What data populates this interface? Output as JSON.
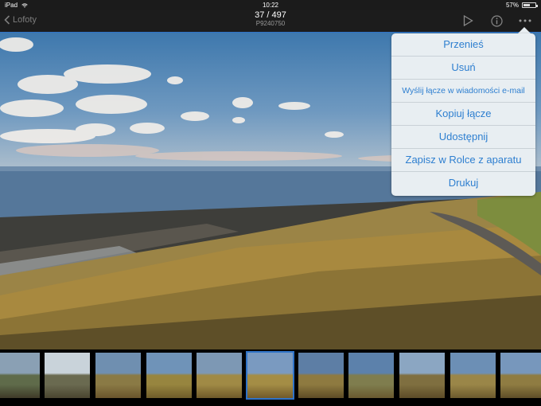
{
  "status_bar": {
    "device": "iPad",
    "time": "10:22",
    "battery": "57%",
    "battery_level": 0.57
  },
  "navbar": {
    "back_label": "Lofoty",
    "title": "37 / 497",
    "subtitle": "P9240750",
    "icons": [
      "play-icon",
      "info-icon",
      "more-icon"
    ]
  },
  "menu": {
    "items": [
      {
        "label": "Przenieś"
      },
      {
        "label": "Usuń"
      },
      {
        "label": "Wyślij łącze w wiadomości e-mail"
      },
      {
        "label": "Kopiuj łącze"
      },
      {
        "label": "Udostępnij"
      },
      {
        "label": "Zapisz w Rolce z aparatu"
      },
      {
        "label": "Drukuj"
      }
    ]
  },
  "filmstrip": {
    "selected_index": 5,
    "count": 11
  },
  "colors": {
    "accent": "#2f73c8",
    "menu_text": "#2e7fd0",
    "menu_bg": "#e8eef2"
  }
}
